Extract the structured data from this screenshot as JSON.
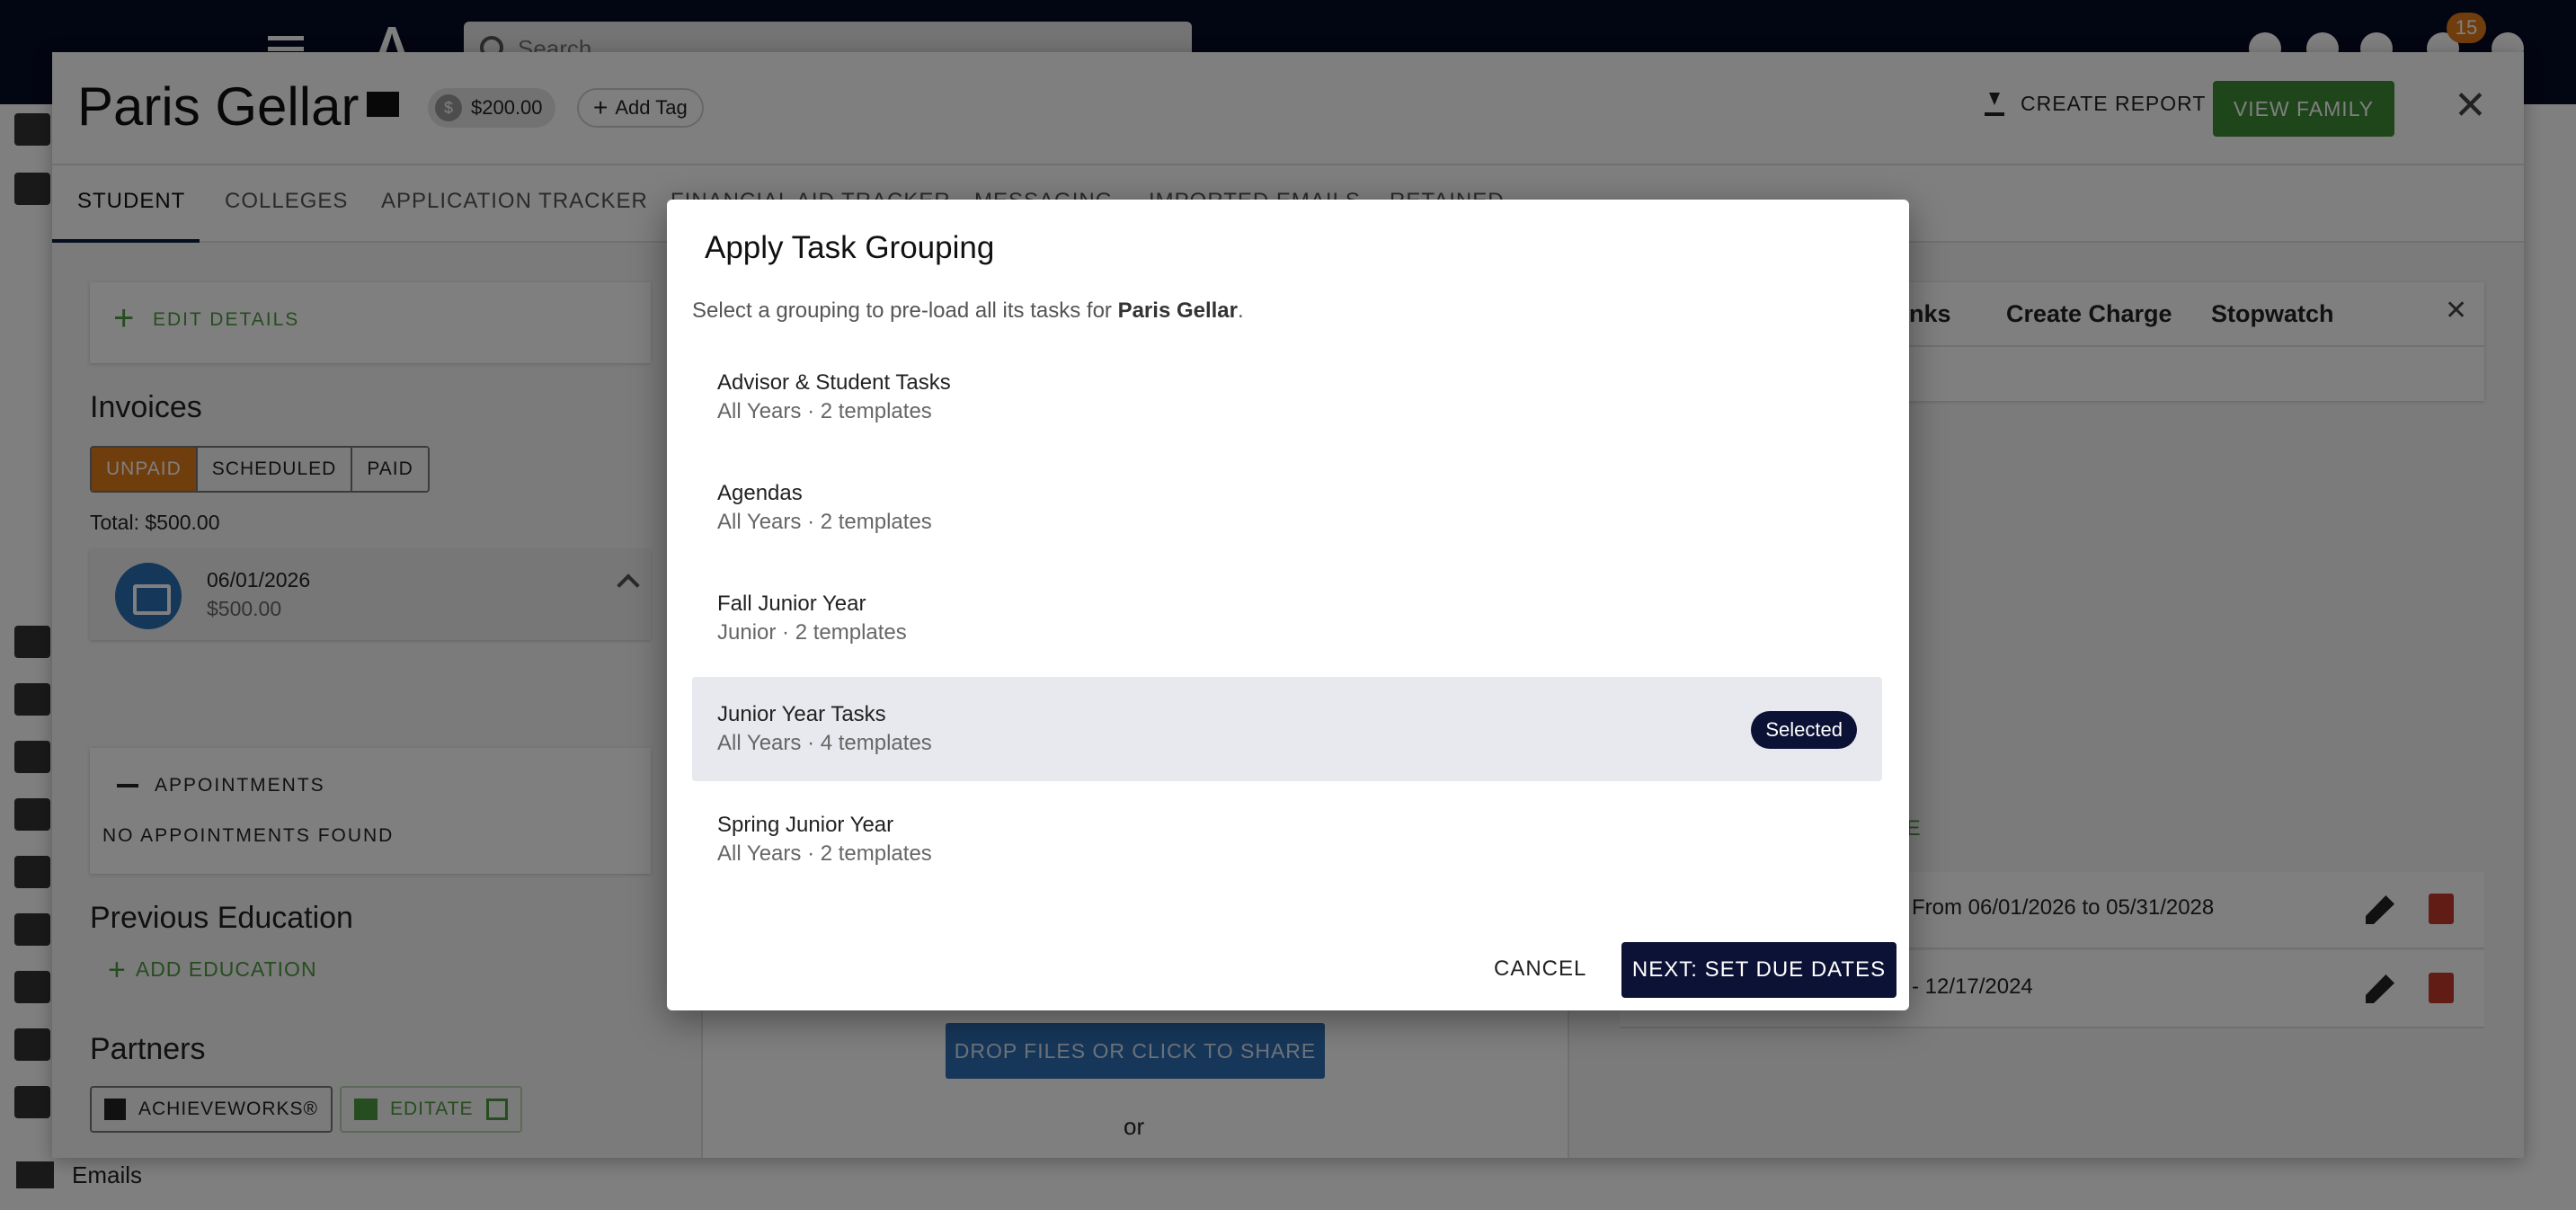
{
  "topbar": {
    "search_placeholder": "Search",
    "notification_count": "15"
  },
  "sidebar": {
    "emails_label": "Emails"
  },
  "student": {
    "name": "Paris Gellar",
    "balance": "$200.00",
    "add_tag_label": "Add Tag",
    "create_report_label": "CREATE REPORT",
    "view_family_label": "VIEW FAMILY"
  },
  "tabs": [
    "STUDENT",
    "COLLEGES",
    "APPLICATION TRACKER",
    "FINANCIAL AID TRACKER",
    "MESSAGING",
    "IMPORTED EMAILS",
    "RETAINED"
  ],
  "left": {
    "edit_details_label": "EDIT DETAILS",
    "invoices_title": "Invoices",
    "invoice_filters": [
      "UNPAID",
      "SCHEDULED",
      "PAID"
    ],
    "total_label": "Total: $500.00",
    "invoice": {
      "date": "06/01/2026",
      "amount": "$500.00"
    },
    "appointments_title": "APPOINTMENTS",
    "appointments_empty": "NO APPOINTMENTS FOUND",
    "previous_education_title": "Previous Education",
    "add_education_label": "ADD EDUCATION",
    "partners_title": "Partners",
    "partners": [
      "ACHIEVEWORKS®",
      "EDITATE"
    ]
  },
  "middle": {
    "drop_files_label": "DROP FILES OR CLICK TO SHARE",
    "or_label": "or"
  },
  "right": {
    "tools": [
      "Links",
      "Create Charge",
      "Stopwatch"
    ],
    "green_link": "GE",
    "rows": [
      "From 06/01/2026 to 05/31/2028",
      "- 12/17/2024"
    ]
  },
  "modal": {
    "title": "Apply Task Grouping",
    "description_prefix": "Select a grouping to pre-load all its tasks for ",
    "description_student": "Paris Gellar",
    "description_suffix": ".",
    "items": [
      {
        "name": "Advisor & Student Tasks",
        "meta": "All Years · 2 templates",
        "selected": false
      },
      {
        "name": "Agendas",
        "meta": "All Years · 2 templates",
        "selected": false
      },
      {
        "name": "Fall Junior Year",
        "meta": "Junior · 2 templates",
        "selected": false
      },
      {
        "name": "Junior Year Tasks",
        "meta": "All Years · 4 templates",
        "selected": true
      },
      {
        "name": "Spring Junior Year",
        "meta": "All Years · 2 templates",
        "selected": false
      }
    ],
    "selected_badge": "Selected",
    "cancel_label": "CANCEL",
    "next_label": "NEXT: SET DUE DATES"
  },
  "colors": {
    "navy": "#0c1236",
    "topbar": "#050a24",
    "green": "#4c9a3f",
    "view_family_green": "#3f8a36",
    "orange": "#e07a1b",
    "blue": "#2f6fb5",
    "selected_bg": "#e8e9ee"
  }
}
